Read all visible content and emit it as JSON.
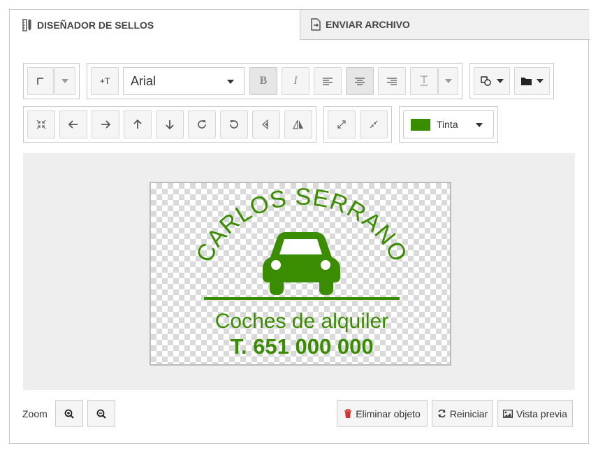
{
  "tabs": {
    "designer": "DISEÑADOR DE SELLOS",
    "send_file": "ENVIAR ARCHIVO"
  },
  "toolbar": {
    "font_select": "Arial",
    "bold": "B",
    "italic": "I",
    "add_text": "+T",
    "color_label": "Tinta",
    "ink_color": "#3a8c00"
  },
  "stamp": {
    "arc_text": "CARLOS SERRANO",
    "icon": "car-icon",
    "line1": "Coches de alquiler",
    "line2": "T. 651 000 000",
    "color": "#3a8c00"
  },
  "footer": {
    "zoom_label": "Zoom",
    "delete_label": "Eliminar objeto",
    "reset_label": "Reiniciar",
    "preview_label": "Vista previa"
  }
}
